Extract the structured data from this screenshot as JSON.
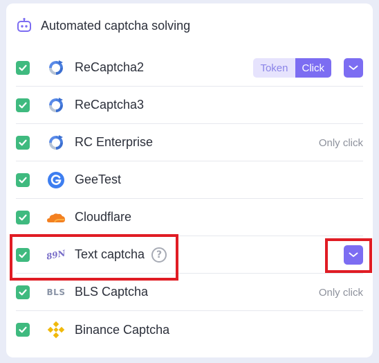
{
  "header": {
    "title": "Automated captcha solving",
    "icon": "robot-icon"
  },
  "colors": {
    "accent": "#7c6df2",
    "check": "#3fba7f",
    "highlight": "#e01c24"
  },
  "rows": [
    {
      "label": "ReCaptcha2",
      "icon": "recaptcha-icon",
      "checked": true,
      "mode_options": [
        "Token",
        "Click"
      ],
      "selected_mode": "Click",
      "has_dropdown": true
    },
    {
      "label": "ReCaptcha3",
      "icon": "recaptcha-icon",
      "checked": true
    },
    {
      "label": "RC Enterprise",
      "icon": "recaptcha-icon",
      "checked": true,
      "note": "Only click"
    },
    {
      "label": "GeeTest",
      "icon": "geetest-icon",
      "checked": true
    },
    {
      "label": "Cloudflare",
      "icon": "cloudflare-icon",
      "checked": true
    },
    {
      "label": "Text captcha",
      "icon": "text-captcha-icon",
      "logo_text": "89N",
      "checked": true,
      "has_help": true,
      "help_glyph": "?",
      "has_dropdown": true
    },
    {
      "label": "BLS Captcha",
      "icon": "bls-icon",
      "logo_text": "BLS",
      "checked": true,
      "note": "Only click"
    },
    {
      "label": "Binance Captcha",
      "icon": "binance-icon",
      "checked": true
    }
  ]
}
